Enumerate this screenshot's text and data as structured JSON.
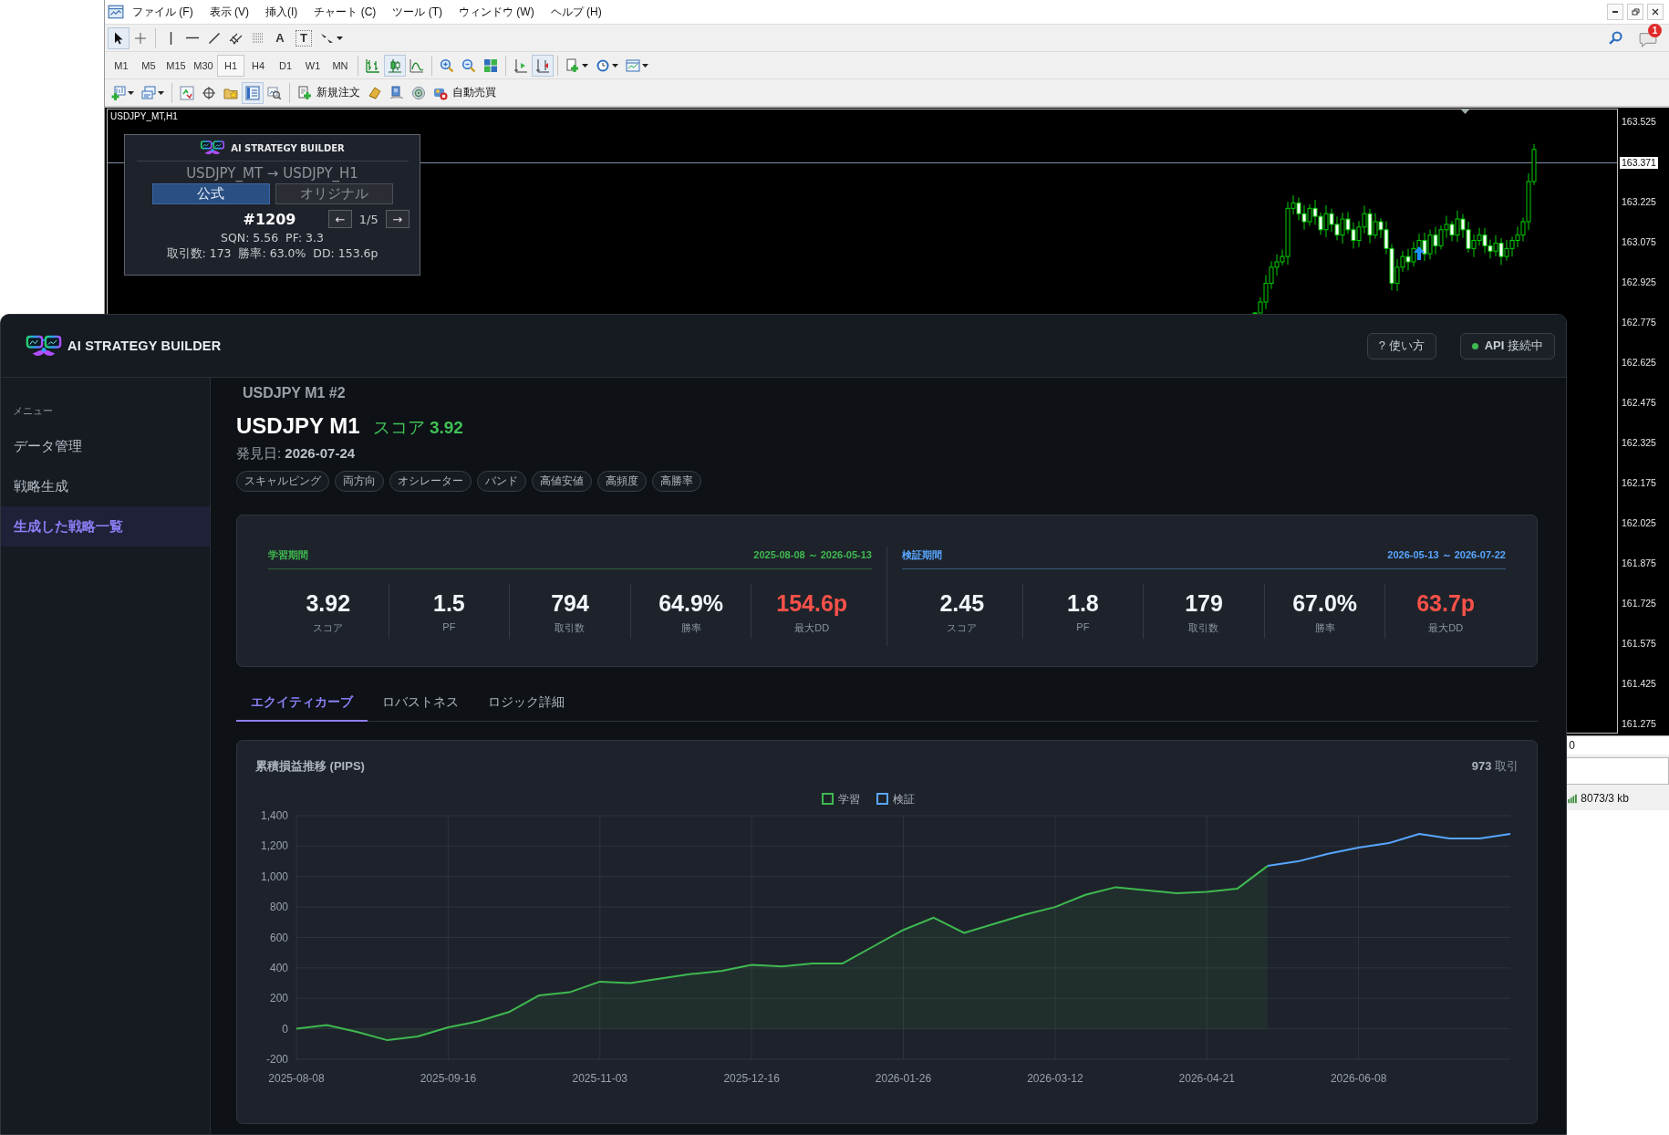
{
  "mt4": {
    "menu": [
      "ファイル (F)",
      "表示 (V)",
      "挿入(I)",
      "チャート (C)",
      "ツール (T)",
      "ウィンドウ (W)",
      "ヘルプ (H)"
    ],
    "notification_count": "1",
    "drawing_tools": [
      {
        "kind": "icon",
        "selected": true
      },
      {
        "kind": "icon",
        "selected": false
      },
      {
        "kind": "icon",
        "selected": false
      },
      {
        "kind": "icon",
        "selected": false
      },
      {
        "kind": "icon",
        "selected": false
      },
      {
        "kind": "icon",
        "selected": false
      },
      {
        "kind": "icon",
        "selected": false
      },
      {
        "kind": "letter",
        "label": "A",
        "selected": false
      },
      {
        "kind": "letter",
        "label": "T",
        "selected": false
      },
      {
        "kind": "icon",
        "selected": false
      }
    ],
    "timeframes": [
      {
        "label": "M1",
        "selected": false
      },
      {
        "label": "M5",
        "selected": false
      },
      {
        "label": "M15",
        "selected": false
      },
      {
        "label": "M30",
        "selected": false
      },
      {
        "label": "H1",
        "selected": true
      },
      {
        "label": "H4",
        "selected": false
      },
      {
        "label": "D1",
        "selected": false
      },
      {
        "label": "W1",
        "selected": false
      },
      {
        "label": "MN",
        "selected": false
      }
    ],
    "chart_tools": [
      {
        "selected": false
      },
      {
        "selected": true
      },
      {
        "selected": false
      },
      {
        "selected": false
      },
      {
        "selected": false
      },
      {
        "selected": false
      },
      {
        "selected": false
      },
      {
        "selected": true
      },
      {
        "selected": false
      },
      {
        "selected": false
      },
      {
        "selected": false
      }
    ],
    "standard_tools": [
      {
        "kind": "icon",
        "selected": false
      },
      {
        "kind": "icon",
        "selected": false
      },
      {
        "kind": "icon",
        "selected": false
      },
      {
        "kind": "icon",
        "selected": false
      },
      {
        "kind": "icon",
        "selected": false
      },
      {
        "kind": "icon",
        "selected": true
      },
      {
        "kind": "icon",
        "selected": false
      },
      {
        "kind": "labeled",
        "label": "新規注文",
        "selected": false
      },
      {
        "kind": "icon",
        "selected": false
      },
      {
        "kind": "icon",
        "selected": false
      },
      {
        "kind": "icon",
        "selected": false
      },
      {
        "kind": "labeled",
        "label": "自動売買",
        "selected": false
      }
    ],
    "chart": {
      "title": "USDJPY_MT,H1",
      "current_price": "163.371",
      "price_ticks": [
        "163.525",
        "163.225",
        "163.075",
        "162.925",
        "162.775",
        "162.625",
        "162.475",
        "162.325",
        "162.175",
        "162.025",
        "161.875",
        "161.725",
        "161.575",
        "161.425",
        "161.275"
      ],
      "time_label": "0"
    },
    "status_bar": {
      "traffic": "8073/3 kb"
    }
  },
  "widget": {
    "brand": "AI STRATEGY BUILDER",
    "symbols": "USDJPY_MT → USDJPY_H1",
    "modes": [
      {
        "label": "公式",
        "selected": true
      },
      {
        "label": "オリジナル",
        "selected": false
      }
    ],
    "strategy_id": "#1209",
    "prev": "←",
    "page": "1/5",
    "next": "→",
    "metrics_line_1": "SQN: 5.56  PF: 3.3",
    "metrics_line_2": "取引数: 173  勝率: 63.0%  DD: 153.6p"
  },
  "dashboard": {
    "brand": "AI STRATEGY BUILDER",
    "help_button": "? 使い方",
    "api_status": {
      "label": "**API** 接続中",
      "connected": true
    },
    "sidebar": {
      "heading": "メニュー",
      "items": [
        {
          "label": "データ管理",
          "selected": false
        },
        {
          "label": "戦略生成",
          "selected": false
        },
        {
          "label": "生成した戦略一覧",
          "selected": true
        }
      ]
    },
    "breadcrumb": "USDJPY M1 #2",
    "title": "USDJPY M1",
    "score": "スコア **3.92**",
    "discovered": "発見日: **2026-07-24**",
    "tags": [
      "スキャルピング",
      "両方向",
      "オシレーター",
      "バンド",
      "高値安値",
      "高頻度",
      "高勝率"
    ],
    "periods": [
      {
        "name": "学習期間",
        "range": "2025-08-08 ～ 2026-05-13",
        "color": "#3fb950",
        "stats": [
          {
            "value": "3.92",
            "label": "スコア",
            "color": "#f0f6fc"
          },
          {
            "value": "1.5",
            "label": "PF",
            "color": "#f0f6fc"
          },
          {
            "value": "794",
            "label": "取引数",
            "color": "#f0f6fc"
          },
          {
            "value": "64.9%",
            "label": "勝率",
            "color": "#f0f6fc"
          },
          {
            "value": "154.6p",
            "label": "最大DD",
            "color": "#f85149"
          }
        ]
      },
      {
        "name": "検証期間",
        "range": "2026-05-13 ～ 2026-07-22",
        "color": "#58a6ff",
        "stats": [
          {
            "value": "2.45",
            "label": "スコア",
            "color": "#f0f6fc"
          },
          {
            "value": "1.8",
            "label": "PF",
            "color": "#f0f6fc"
          },
          {
            "value": "179",
            "label": "取引数",
            "color": "#f0f6fc"
          },
          {
            "value": "67.0%",
            "label": "勝率",
            "color": "#f0f6fc"
          },
          {
            "value": "63.7p",
            "label": "最大DD",
            "color": "#f85149"
          }
        ]
      }
    ],
    "tabs": [
      {
        "label": "エクイティカーブ",
        "selected": true
      },
      {
        "label": "ロバストネス",
        "selected": false
      },
      {
        "label": "ロジック詳細",
        "selected": false
      }
    ],
    "chart": {
      "trade_count": "**973** 取引",
      "chart_data": {
        "type": "line",
        "title": "累積損益推移 (PIPS)",
        "categories": [
          "2025-08-08",
          null,
          null,
          null,
          null,
          "2025-09-16",
          null,
          null,
          null,
          null,
          "2025-11-03",
          null,
          null,
          null,
          null,
          "2025-12-16",
          null,
          null,
          null,
          null,
          "2026-01-26",
          null,
          null,
          null,
          null,
          "2026-03-12",
          null,
          null,
          null,
          null,
          "2026-04-21",
          null,
          null,
          null,
          null,
          "2026-06-08",
          null,
          null,
          null,
          null,
          null
        ],
        "series": [
          {
            "name": "学習",
            "color": "#3fb950",
            "values": [
              0,
              25,
              -20,
              -75,
              -50,
              10,
              50,
              110,
              220,
              240,
              310,
              300,
              330,
              360,
              380,
              420,
              410,
              430,
              430,
              540,
              650,
              730,
              630,
              690,
              750,
              800,
              880,
              930,
              910,
              890,
              900,
              920,
              1070,
              null,
              null,
              null,
              null,
              null,
              null,
              null,
              null
            ]
          },
          {
            "name": "検証",
            "color": "#58a6ff",
            "values": [
              null,
              null,
              null,
              null,
              null,
              null,
              null,
              null,
              null,
              null,
              null,
              null,
              null,
              null,
              null,
              null,
              null,
              null,
              null,
              null,
              null,
              null,
              null,
              null,
              null,
              null,
              null,
              null,
              null,
              null,
              null,
              null,
              1070,
              1100,
              1150,
              1190,
              1220,
              1280,
              1250,
              1250,
              1280
            ]
          }
        ],
        "ylim": [
          -200,
          1400
        ],
        "grid": true,
        "legend": "top",
        "yticks": [
          {
            "value": -200,
            "label": "-200"
          },
          {
            "value": 0,
            "label": "0"
          },
          {
            "value": 200,
            "label": "200"
          },
          {
            "value": 400,
            "label": "400"
          },
          {
            "value": 600,
            "label": "600"
          },
          {
            "value": 800,
            "label": "800"
          },
          {
            "value": 1000,
            "label": "1,000"
          },
          {
            "value": 1200,
            "label": "1,200"
          },
          {
            "value": 1400,
            "label": "1,400"
          }
        ]
      }
    }
  }
}
